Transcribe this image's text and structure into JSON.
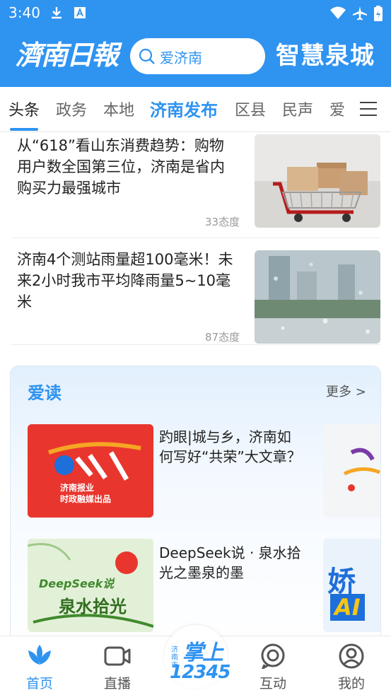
{
  "status_bar": {
    "time": "3:40",
    "icons": [
      "download-icon",
      "font-a-icon",
      "wifi-icon",
      "airplane-icon",
      "battery-icon"
    ]
  },
  "header": {
    "logo_left": "濟南日報",
    "search_placeholder": "爱济南",
    "logo_right": "智慧泉城"
  },
  "tabs": [
    {
      "label": "头条",
      "selected": true
    },
    {
      "label": "政务"
    },
    {
      "label": "本地"
    },
    {
      "label": "济南发布",
      "highlight": true
    },
    {
      "label": "区县"
    },
    {
      "label": "民声"
    },
    {
      "label": "爱"
    }
  ],
  "news": [
    {
      "title": "从“618”看山东消费趋势：购物用户数全国第三位，济南是省内购买力最强城市",
      "meta": "33态度",
      "thumb": "shopping-cart-boxes-image"
    },
    {
      "title": "济南4个测站雨量超100毫米！未来2小时我市平均降雨量5~10毫米",
      "meta": "87态度",
      "thumb": "rainy-window-city-image"
    }
  ],
  "aidu": {
    "title": "爱读",
    "more": "更多 >",
    "items": [
      {
        "title": "趵眼|城与乡，济南如何写好“共荣”大文章？",
        "thumb_lines": [
          "济南报业",
          "时政融媒出品"
        ]
      },
      {
        "title": "DeepSeek说 · 泉水拾光之墨泉的墨",
        "thumb_lines": [
          "DeepSeek说",
          "泉水拾光"
        ]
      }
    ],
    "peek_text": [
      "娇",
      "AI"
    ]
  },
  "bottom_nav": {
    "items": [
      {
        "label": "首页",
        "icon": "lotus-home-icon",
        "active": true
      },
      {
        "label": "直播",
        "icon": "video-camera-icon"
      },
      {
        "label": "互动",
        "icon": "chat-bubble-icon"
      },
      {
        "label": "我的",
        "icon": "user-profile-icon"
      }
    ],
    "center": {
      "small": "济南市",
      "big": "掌上",
      "num": "12345"
    }
  },
  "colors": {
    "brand_blue": "#2f93f0",
    "promo_red": "#e8362e",
    "promo_green": "#3f8a2c"
  }
}
